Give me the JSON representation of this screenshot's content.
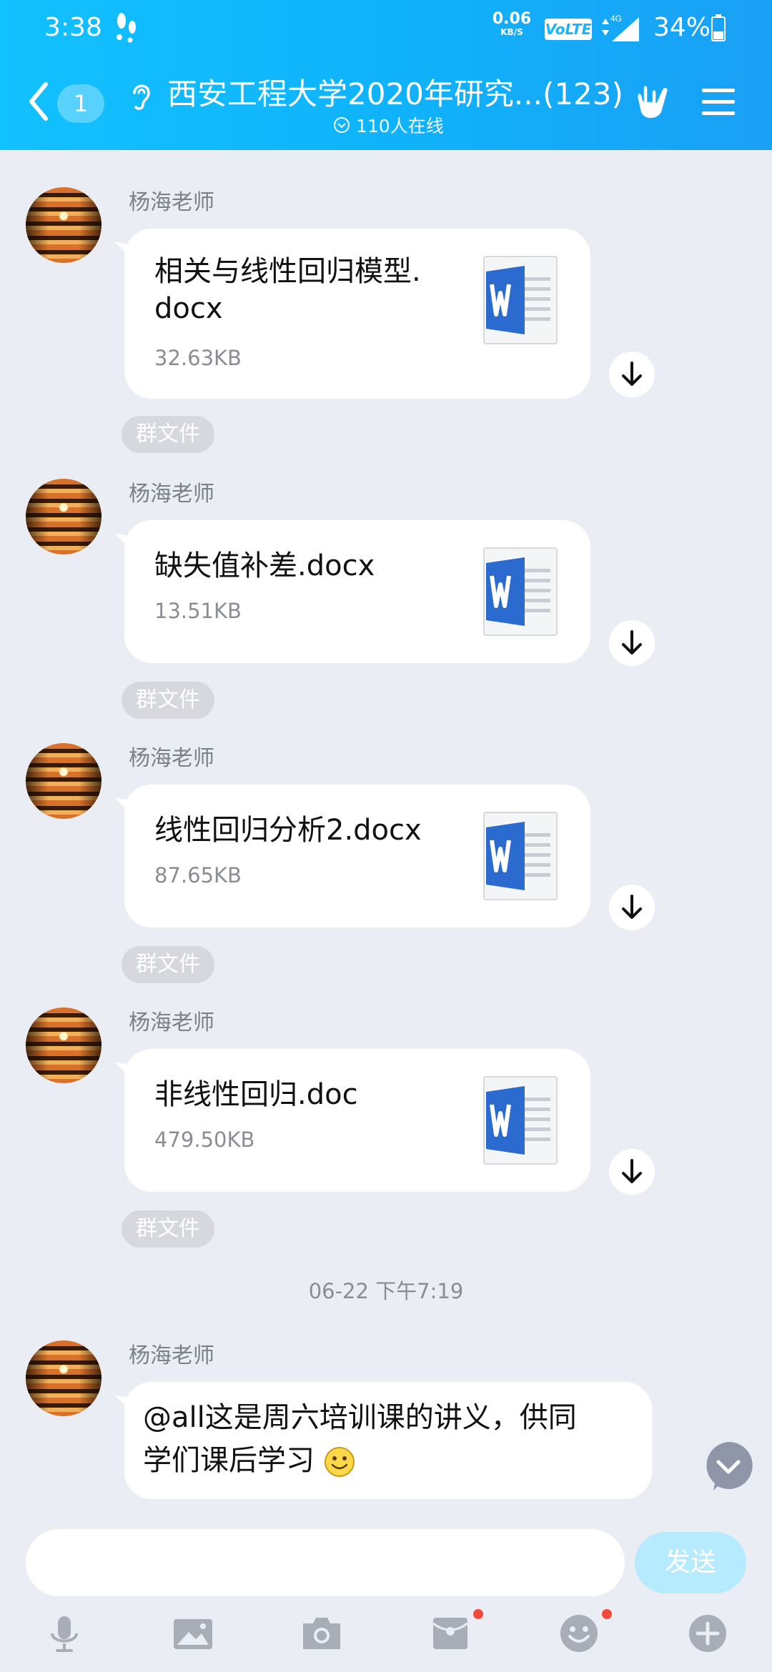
{
  "status_bar": {
    "time": "3:38",
    "net_speed": "0.06",
    "net_speed_unit": "KB/S",
    "volte": "VoLTE",
    "network": "4G",
    "battery": "34%"
  },
  "header": {
    "unread_count": "1",
    "title": "西安工程大学2020年研究...(123)",
    "online": "110人在线"
  },
  "messages": [
    {
      "sender": "杨海老师",
      "file_name_line1": "相关与线性回归模型.",
      "file_name_line2": "docx",
      "file_size": "32.63KB",
      "tag": "群文件"
    },
    {
      "sender": "杨海老师",
      "file_name_line1": "缺失值补差.docx",
      "file_size": "13.51KB",
      "tag": "群文件"
    },
    {
      "sender": "杨海老师",
      "file_name_line1": "线性回归分析2.docx",
      "file_size": "87.65KB",
      "tag": "群文件"
    },
    {
      "sender": "杨海老师",
      "file_name_line1": "非线性回归.doc",
      "file_size": "479.50KB",
      "tag": "群文件"
    }
  ],
  "time_separator": "06-22 下午7:19",
  "text_message": {
    "sender": "杨海老师",
    "line1": "@all这是周六培训课的讲义，供同",
    "line2": "学们课后学习"
  },
  "input": {
    "placeholder": "",
    "send_label": "发送"
  },
  "toolbar": [
    "microphone-icon",
    "image-icon",
    "camera-icon",
    "red-packet-icon",
    "emoji-icon",
    "plus-icon"
  ],
  "colors": {
    "header": "#12b6fb",
    "background": "#eaedf4",
    "word_blue": "#2b6bd0"
  }
}
